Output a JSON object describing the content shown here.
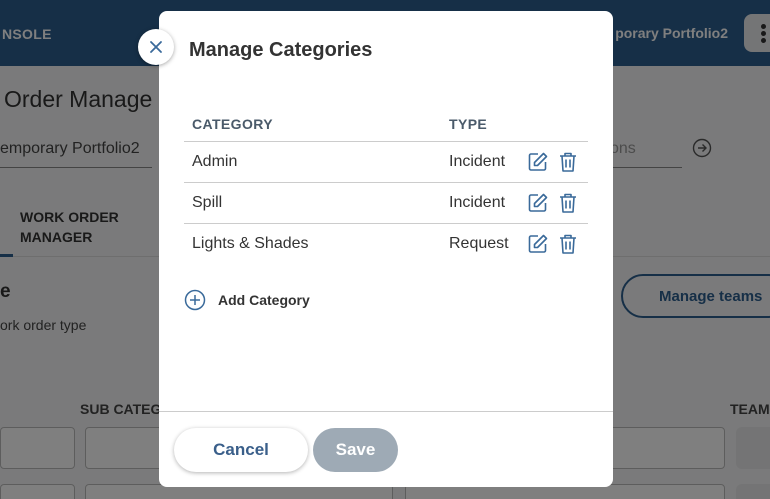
{
  "background": {
    "brand_fragment": "NSOLE",
    "portfolio_top": "porary Portfolio2",
    "page_title": "Order Manage",
    "portfolio_field": "emporary Portfolio2",
    "search_fragment": "ons",
    "tab_line1": "WORK ORDER",
    "tab_line2": "MANAGER",
    "section_letter": "e",
    "section_desc": "ork order type",
    "manage_teams": "Manage teams",
    "col_subcat": "SUB CATEG",
    "col_team": "TEAM"
  },
  "modal": {
    "title": "Manage Categories",
    "table": {
      "headers": [
        "CATEGORY",
        "TYPE"
      ],
      "rows": [
        {
          "category": "Admin",
          "type": "Incident"
        },
        {
          "category": "Spill",
          "type": "Incident"
        },
        {
          "category": "Lights & Shades",
          "type": "Request"
        }
      ]
    },
    "add_category": "Add Category",
    "cancel": "Cancel",
    "save": "Save"
  },
  "colors": {
    "topbar": "#2d5f8f",
    "accent": "#3a6a9a",
    "save_disabled": "#9eaab5"
  },
  "icons": [
    "close-icon",
    "edit-icon",
    "trash-icon",
    "plus-circle-icon",
    "arrow-circle-icon",
    "app-grid-icon",
    "team-icon"
  ]
}
